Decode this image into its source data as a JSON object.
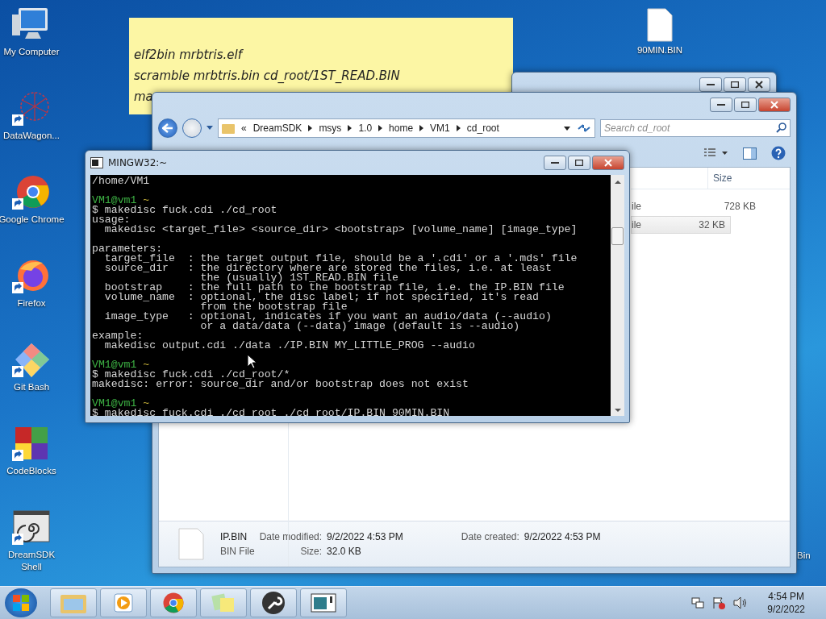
{
  "desktop_icons": [
    {
      "kind": "computer",
      "label": "My Computer"
    },
    {
      "kind": "network",
      "label": "DataWagon..."
    },
    {
      "kind": "browser",
      "label": "Google Chrome"
    },
    {
      "kind": "fox",
      "label": "Firefox"
    },
    {
      "kind": "diamond",
      "label": "Git Bash"
    },
    {
      "kind": "blocks",
      "label": "CodeBlocks"
    },
    {
      "kind": "spiral",
      "label": "DreamSDK Shell"
    }
  ],
  "desktop_file": {
    "label": "90MIN.BIN"
  },
  "desktop_edge_label": "Bin",
  "sticky_note": {
    "lines": [
      "elf2bin mrbtris.elf",
      "scramble mrbtris.bin cd_root/1ST_READ.BIN",
      "ma"
    ]
  },
  "explorer": {
    "breadcrumb_overflow": "«",
    "path": [
      "DreamSDK",
      "msys",
      "1.0",
      "home",
      "VM1",
      "cd_root"
    ],
    "search": {
      "placeholder": "Search cd_root"
    },
    "columns": [
      "Size"
    ],
    "rows": [
      {
        "type": "ile",
        "size": "728 KB",
        "selected": false
      },
      {
        "type": "ile",
        "size": "32 KB",
        "selected": true
      }
    ],
    "details": {
      "name": "IP.BIN",
      "type": "BIN File",
      "modified_label": "Date modified:",
      "modified": "9/2/2022 4:53 PM",
      "size_label": "Size:",
      "size": "32.0 KB",
      "created_label": "Date created:",
      "created": "9/2/2022 4:53 PM"
    }
  },
  "terminal": {
    "title": "MINGW32:~",
    "lines": [
      {
        "kind": "text",
        "text": "/home/VM1"
      },
      {
        "kind": "blank"
      },
      {
        "kind": "prompt",
        "user": "VM1@vm1",
        "dir": "~"
      },
      {
        "kind": "text",
        "text": "$ makedisc fuck.cdi ./cd_root"
      },
      {
        "kind": "text",
        "text": "usage:"
      },
      {
        "kind": "text",
        "text": "  makedisc <target_file> <source_dir> <bootstrap> [volume_name] [image_type]"
      },
      {
        "kind": "blank"
      },
      {
        "kind": "text",
        "text": "parameters:"
      },
      {
        "kind": "text",
        "text": "  target_file  : the target output file, should be a '.cdi' or a '.mds' file"
      },
      {
        "kind": "text",
        "text": "  source_dir   : the directory where are stored the files, i.e. at least"
      },
      {
        "kind": "text",
        "text": "                 the (usually) 1ST_READ.BIN file"
      },
      {
        "kind": "text",
        "text": "  bootstrap    : the full path to the bootstrap file, i.e. the IP.BIN file"
      },
      {
        "kind": "text",
        "text": "  volume_name  : optional, the disc label; if not specified, it's read"
      },
      {
        "kind": "text",
        "text": "                 from the bootstrap file"
      },
      {
        "kind": "text",
        "text": "  image_type   : optional, indicates if you want an audio/data (--audio)"
      },
      {
        "kind": "text",
        "text": "                 or a data/data (--data) image (default is --audio)"
      },
      {
        "kind": "text",
        "text": "example:"
      },
      {
        "kind": "text",
        "text": "  makedisc output.cdi ./data ./IP.BIN MY_LITTLE_PROG --audio"
      },
      {
        "kind": "blank"
      },
      {
        "kind": "prompt",
        "user": "VM1@vm1",
        "dir": "~"
      },
      {
        "kind": "text",
        "text": "$ makedisc fuck.cdi ./cd_root/*"
      },
      {
        "kind": "text",
        "text": "makedisc: error: source_dir and/or bootstrap does not exist"
      },
      {
        "kind": "blank"
      },
      {
        "kind": "prompt",
        "user": "VM1@vm1",
        "dir": "~"
      },
      {
        "kind": "text",
        "text": "$ makedisc fuck.cdi ./cd_root ./cd_root/IP.BIN 90MIN.BIN"
      }
    ]
  },
  "taskbar": {
    "apps": [
      {
        "kind": "folder"
      },
      {
        "kind": "media"
      },
      {
        "kind": "browser"
      },
      {
        "kind": "notes"
      },
      {
        "kind": "wrench"
      },
      {
        "kind": "window"
      }
    ],
    "time": "4:54 PM",
    "date": "9/2/2022"
  }
}
